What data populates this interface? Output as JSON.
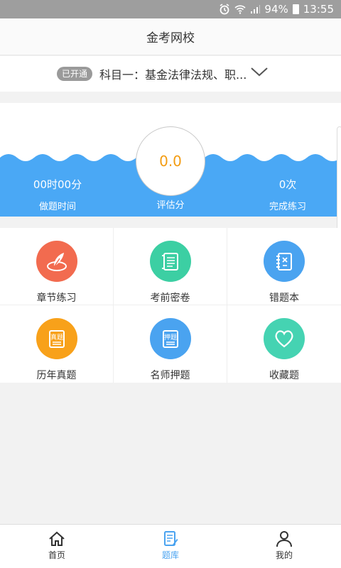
{
  "status_bar": {
    "battery": "94%",
    "time": "13:55"
  },
  "header": {
    "title": "金考网校"
  },
  "subject": {
    "badge": "已开通",
    "name": "科目一：基金法律法规、职..."
  },
  "stats": {
    "time_value": "00时00分",
    "time_label": "做题时间",
    "score_value": "0.0",
    "score_label": "评估分",
    "count_value": "0次",
    "count_label": "完成练习"
  },
  "grid": [
    {
      "label": "章节练习",
      "icon": "quill-icon",
      "color": "#f26b4f"
    },
    {
      "label": "考前密卷",
      "icon": "scroll-icon",
      "color": "#3ccfa3"
    },
    {
      "label": "错题本",
      "icon": "notebook-icon",
      "color": "#4aa3f0"
    },
    {
      "label": "历年真题",
      "icon": "exam-paper-icon",
      "color": "#f8a11a"
    },
    {
      "label": "名师押题",
      "icon": "predict-paper-icon",
      "color": "#4aa3f0"
    },
    {
      "label": "收藏题",
      "icon": "heart-icon",
      "color": "#45d3b2"
    }
  ],
  "tabs": [
    {
      "label": "首页",
      "icon": "home-icon"
    },
    {
      "label": "题库",
      "icon": "question-bank-icon",
      "active": true
    },
    {
      "label": "我的",
      "icon": "profile-icon"
    }
  ],
  "colors": {
    "wave_blue": "#4aa8f5",
    "accent": "#4aa3f0",
    "score": "#f39c12"
  }
}
